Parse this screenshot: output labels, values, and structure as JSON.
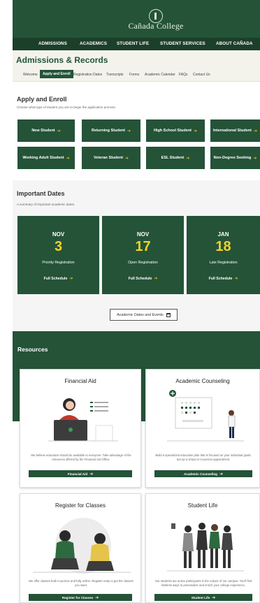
{
  "header": {
    "logo_text": "Cañada College",
    "nav": [
      "ADMISSIONS",
      "ACADEMICS",
      "STUDENT LIFE",
      "STUDENT SERVICES",
      "ABOUT CAÑADA"
    ]
  },
  "page": {
    "title": "Admissions & Records",
    "subnav": [
      "Welcome",
      "Apply and Enroll",
      "Registration Dates",
      "Transcripts",
      "Forms",
      "Academic Calendar",
      "FAQs",
      "Contact Us"
    ],
    "active_subnav": "Apply and Enroll"
  },
  "apply": {
    "title": "Apply and Enroll",
    "subtitle": "Choose what type of student you are to begin the application process.",
    "buttons": [
      "New Student",
      "Returning Student",
      "High School Student",
      "International Student",
      "Working Adult Student",
      "Veteran Student",
      "ESL Student",
      "Non-Degree Seeking"
    ],
    "arrow": "➔"
  },
  "dates": {
    "title": "Important Dates",
    "subtitle": "A summary of important academic dates.",
    "cards": [
      {
        "month": "NOV",
        "day": "3",
        "label": "Priority Registration",
        "link": "Full Schedule"
      },
      {
        "month": "NOV",
        "day": "17",
        "label": "Open Registration",
        "link": "Full Schedule"
      },
      {
        "month": "JAN",
        "day": "18",
        "label": "Late Registration",
        "link": "Full Schedule"
      }
    ],
    "events_button": "Academic Dates and Events"
  },
  "resources": {
    "title": "Resources",
    "cards": [
      {
        "title": "Financial Aid",
        "desc": "We believe education should be available to everyone. Take advantage of the resources offered by the Financial Aid Office.",
        "button": "Financial Aid"
      },
      {
        "title": "Academic Counseling",
        "desc": "Build a specialized education plan that is focused on your individual goals. Set up a virtual or in-person appointment.",
        "button": "Academic Counseling"
      },
      {
        "title": "Register for Classes",
        "desc": "We offer classes both in-person and fully online. Register early to get the classes you want.",
        "button": "Register for Classes"
      },
      {
        "title": "Student Life",
        "desc": "Our students are active participants in the culture of our campus. You'll find limitless ways to personalize and enrich your college experience.",
        "button": "Student Life"
      }
    ]
  },
  "colors": {
    "brand_green": "#245338",
    "accent_yellow": "#f1d22b"
  }
}
